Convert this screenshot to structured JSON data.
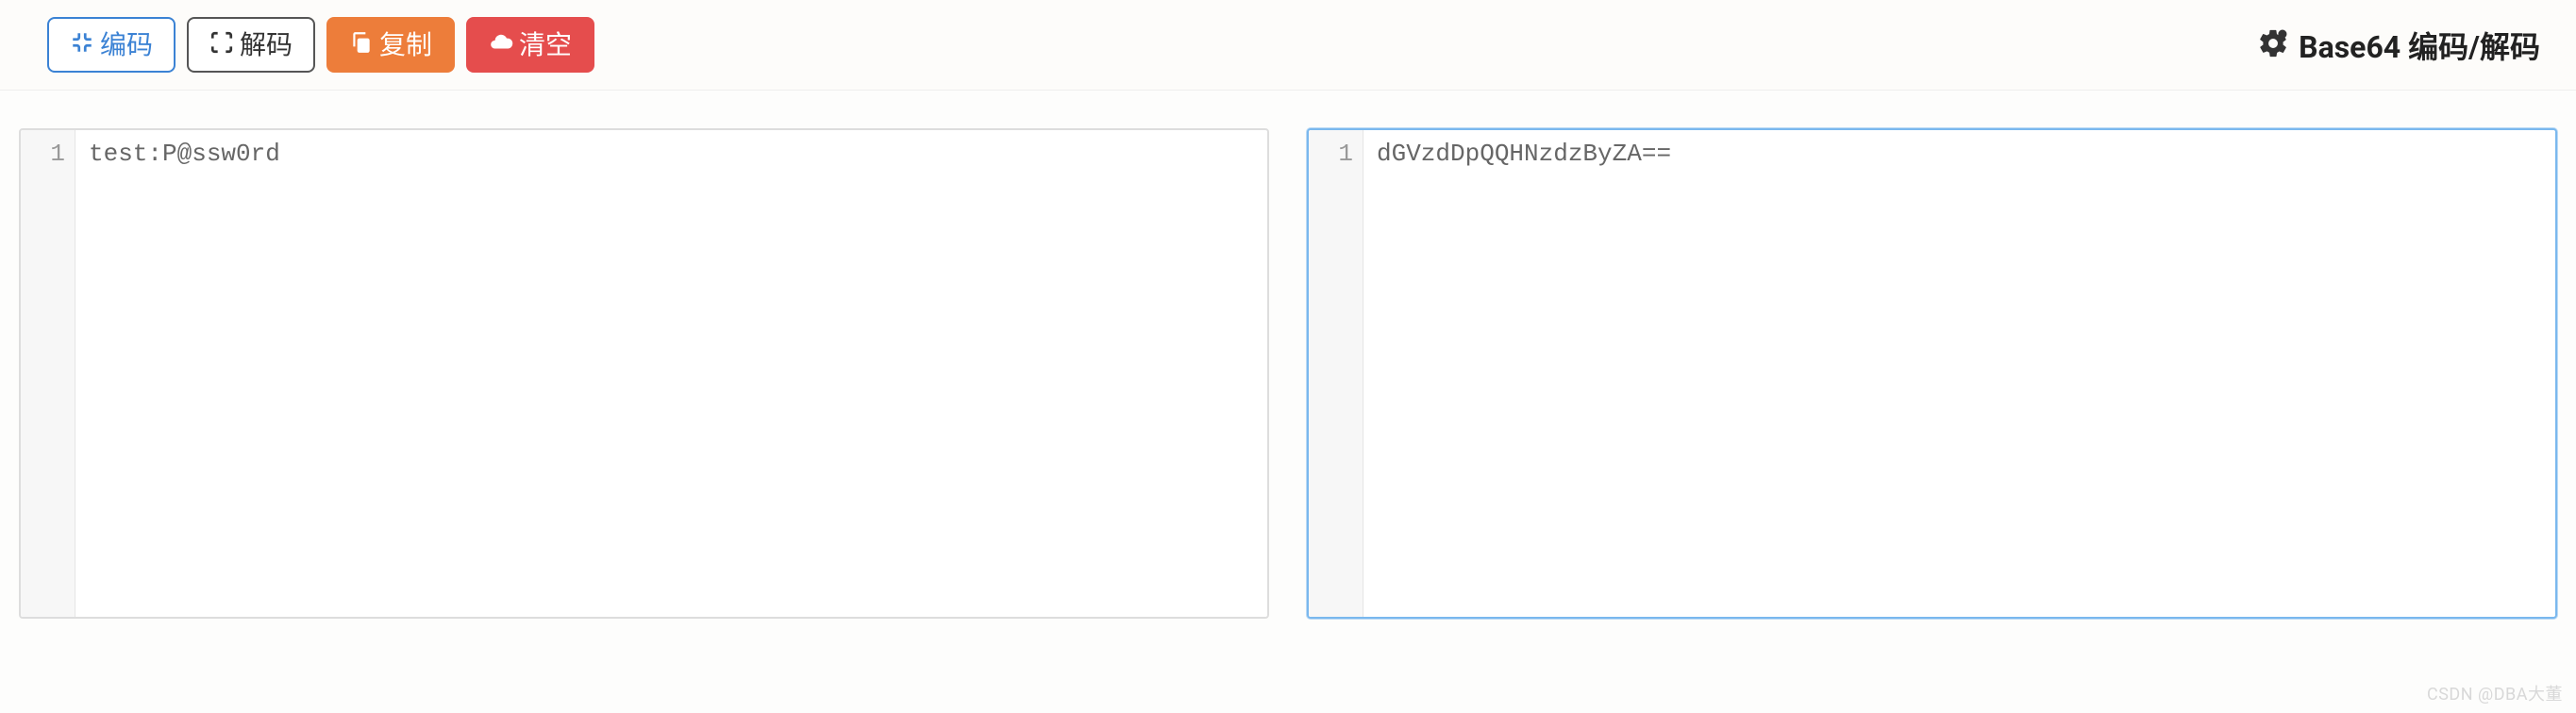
{
  "toolbar": {
    "encode_label": "编码",
    "decode_label": "解码",
    "copy_label": "复制",
    "clear_label": "清空"
  },
  "page": {
    "title": "Base64 编码/解码"
  },
  "editors": {
    "left": {
      "line_number": "1",
      "content": "test:P@ssw0rd"
    },
    "right": {
      "line_number": "1",
      "content": "dGVzdDpQQHNzdzByZA=="
    }
  },
  "watermark": "CSDN @DBA大董"
}
